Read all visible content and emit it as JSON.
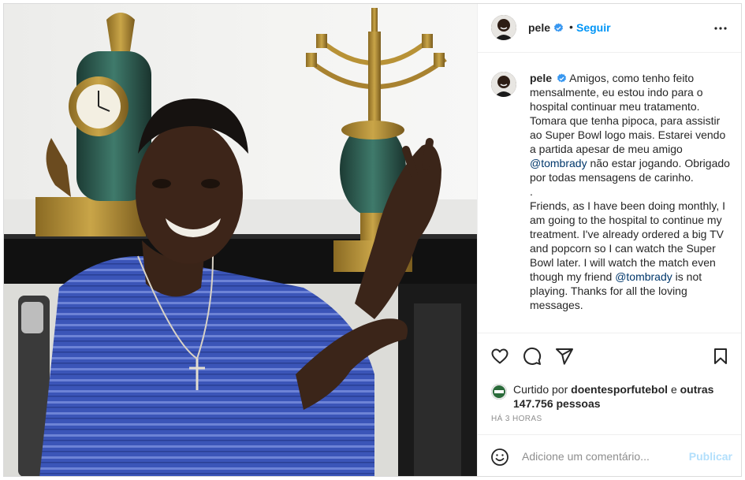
{
  "post": {
    "author": {
      "username": "pele",
      "verified": true,
      "avatar_icon": "profile-photo-avatar"
    },
    "header": {
      "separator": "•",
      "follow_label": "Seguir",
      "more_icon": "more-horizontal-icon"
    },
    "caption": {
      "username": "pele",
      "portuguese": "Amigos, como tenho feito mensalmente, eu estou indo para o hospital continuar meu tratamento. Tomara que tenha pipoca, para assistir ao Super Bowl logo mais. Estarei vendo a partida apesar de meu amigo",
      "mention_pt": "@tombrady",
      "portuguese_end": "não estar jogando. Obrigado por todas mensagens de carinho.",
      "separator_dot": ".",
      "english": "Friends, as I have been doing monthly, I am going to the hospital to continue my treatment. I've already ordered a big TV and popcorn so I can watch the Super Bowl later. I will watch the match even though my friend",
      "mention_en": "@tombrady",
      "english_end": "is not playing. Thanks for all the loving messages."
    },
    "actions": {
      "like_icon": "heart-icon",
      "comment_icon": "comment-bubble-icon",
      "share_icon": "paper-plane-share-icon",
      "save_icon": "bookmark-icon"
    },
    "likes": {
      "prefix": "Curtido por",
      "liked_by": "doentesporfutebol",
      "conjunction": "e",
      "others": "outras 147.756 pessoas"
    },
    "timestamp": "HÁ 3 HORAS",
    "add_comment": {
      "emoji_icon": "smiley-emoji-icon",
      "placeholder": "Adicione um comentário...",
      "publish_label": "Publicar"
    }
  },
  "colors": {
    "link_blue": "#0095f6",
    "publish_disabled": "#b2dffc",
    "mention": "#00376b",
    "text": "#262626",
    "muted": "#8e8e8e",
    "divider": "#efefef",
    "shirt_blue": "#3b55b8"
  }
}
